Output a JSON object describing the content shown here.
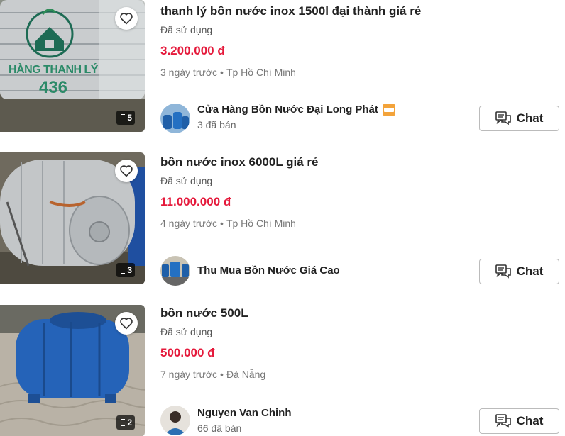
{
  "listings": [
    {
      "title": "thanh lý bồn nước inox 1500l đại thành giá rẻ",
      "condition": "Đã sử dụng",
      "price": "3.200.000 đ",
      "time": "3 ngày trước",
      "location": "Tp Hồ Chí Minh",
      "image_count": "5",
      "watermark_line1": "HÀNG THANH LÝ",
      "watermark_line2": "436",
      "seller": {
        "name": "Cửa Hàng Bồn Nước Đại Long Phát",
        "sold": "3 đã bán",
        "badge_icon": "shop-icon"
      },
      "chat_label": "Chat"
    },
    {
      "title": "bồn nước inox 6000L giá rẻ",
      "condition": "Đã sử dụng",
      "price": "11.000.000 đ",
      "time": "4 ngày trước",
      "location": "Tp Hồ Chí Minh",
      "image_count": "3",
      "seller": {
        "name": "Thu Mua Bồn Nước Giá Cao"
      },
      "chat_label": "Chat"
    },
    {
      "title": "bồn nước 500L",
      "condition": "Đã sử dụng",
      "price": "500.000 đ",
      "time": "7 ngày trước",
      "location": "Đà Nẵng",
      "image_count": "2",
      "seller": {
        "name": "Nguyen Van Chinh",
        "sold": "66 đã bán"
      },
      "chat_label": "Chat"
    }
  ],
  "separator": "•",
  "colors": {
    "price": "#e5193b",
    "text": "#222222",
    "muted": "#777777",
    "border": "#bbbbbb"
  },
  "icons": {
    "favorite": "heart-icon",
    "chat": "chat-bubble-icon",
    "images": "image-count-icon"
  }
}
